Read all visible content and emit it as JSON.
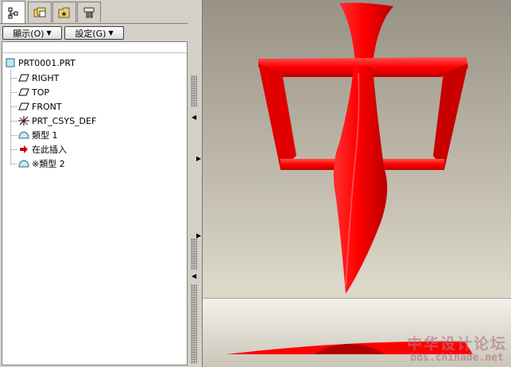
{
  "navigator": {
    "tabs": [
      {
        "icon": "model-tree-icon",
        "active": true
      },
      {
        "icon": "folder-browser-icon",
        "active": false
      },
      {
        "icon": "favorites-icon",
        "active": false
      },
      {
        "icon": "connections-icon",
        "active": false
      }
    ],
    "toolbar": {
      "show_label": "顯示(O)",
      "settings_label": "設定(G)"
    },
    "tree": {
      "root": "PRT0001.PRT",
      "items": [
        {
          "label": "RIGHT",
          "icon": "datum-plane-icon"
        },
        {
          "label": "TOP",
          "icon": "datum-plane-icon"
        },
        {
          "label": "FRONT",
          "icon": "datum-plane-icon"
        },
        {
          "label": "PRT_CSYS_DEF",
          "icon": "coordinate-system-icon"
        },
        {
          "label": "類型 1",
          "icon": "feature-icon"
        },
        {
          "label": "在此插入",
          "icon": "insert-here-arrow-icon"
        },
        {
          "label": "類型 2",
          "icon": "feature-icon",
          "prefix_mark": "※"
        }
      ]
    }
  },
  "viewport": {
    "model_color": "#ff1a1a",
    "background_top": "#989286",
    "floor_color": "#efece3"
  },
  "watermark": {
    "title": "中华设计论坛",
    "url": "bbs.chinade.net"
  }
}
